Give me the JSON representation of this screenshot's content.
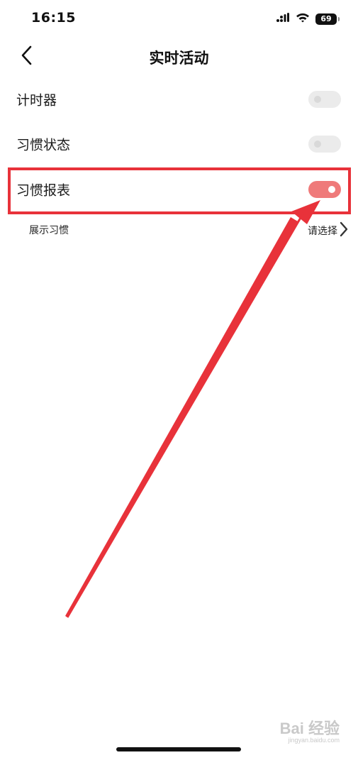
{
  "status_bar": {
    "time": "16:15",
    "battery": "69",
    "signal_icon": "signal-bars-icon",
    "wifi_icon": "wifi-icon"
  },
  "nav": {
    "title": "实时活动",
    "back_icon": "chevron-left-icon"
  },
  "settings": {
    "timer": {
      "label": "计时器",
      "enabled": false
    },
    "habit_status": {
      "label": "习惯状态",
      "enabled": false
    },
    "habit_report": {
      "label": "习惯报表",
      "enabled": true
    }
  },
  "display_habit": {
    "label": "展示习惯",
    "value": "请选择",
    "chevron_icon": "chevron-right-icon"
  },
  "colors": {
    "toggle_on": "#ef7a7a",
    "toggle_off": "#ebebeb",
    "highlight": "#e8323a"
  },
  "watermark": {
    "main": "Bai 经验",
    "url": "jingyan.baidu.com"
  }
}
